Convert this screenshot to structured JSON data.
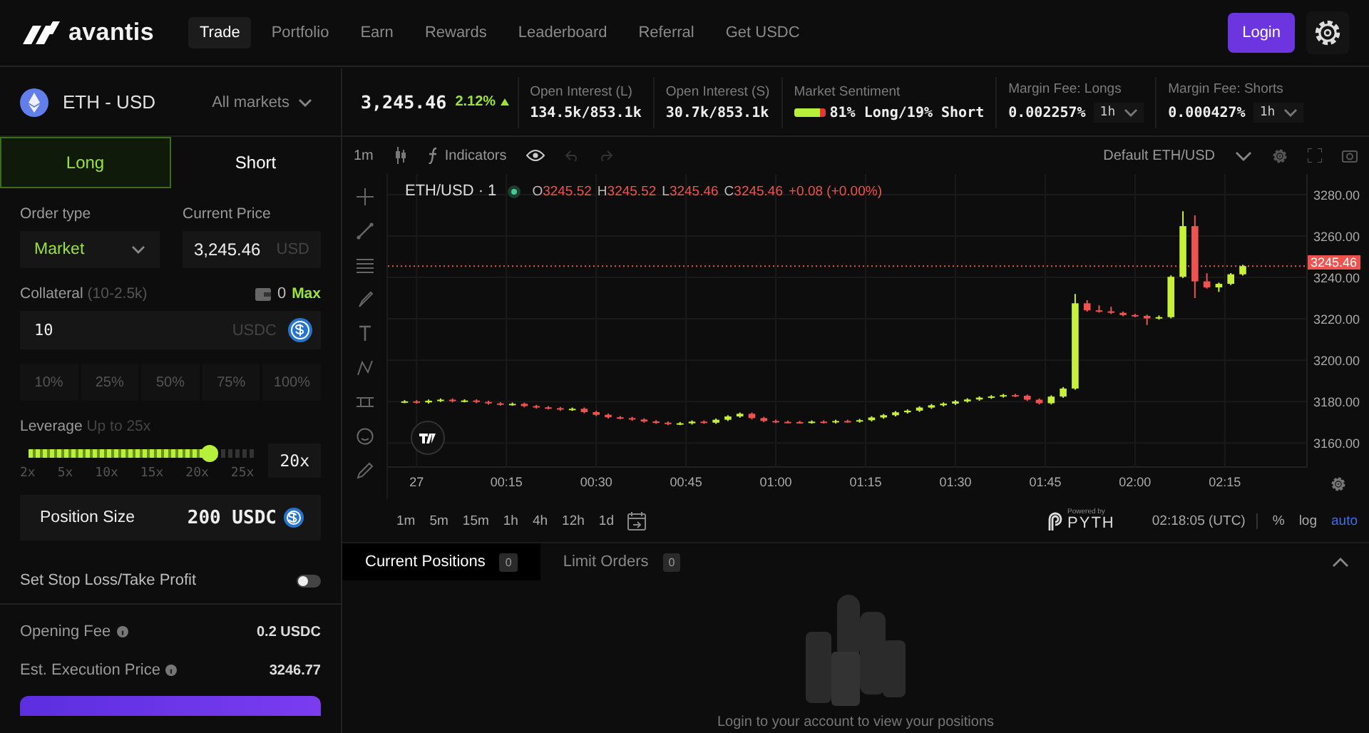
{
  "nav": {
    "brand": "avantis",
    "links": [
      {
        "label": "Trade",
        "selected": true
      },
      {
        "label": "Portfolio",
        "selected": false
      },
      {
        "label": "Earn",
        "selected": false
      },
      {
        "label": "Rewards",
        "selected": false
      },
      {
        "label": "Leaderboard",
        "selected": false
      },
      {
        "label": "Referral",
        "selected": false
      },
      {
        "label": "Get USDC",
        "selected": false
      }
    ],
    "login": "Login"
  },
  "market": {
    "pair": "ETH - USD",
    "selector": "All markets",
    "price": "3,245.46",
    "change": "2.12%",
    "stats": [
      {
        "kind": "plain",
        "label": "Open Interest (L)",
        "value": "134.5k/853.1k"
      },
      {
        "kind": "plain",
        "label": "Open Interest (S)",
        "value": "30.7k/853.1k"
      },
      {
        "kind": "sentiment",
        "label": "Market Sentiment",
        "value": "81% Long/19% Short",
        "level": 0.81
      },
      {
        "kind": "fee",
        "label": "Margin Fee: Longs",
        "value": "0.002257%",
        "period": "1h"
      },
      {
        "kind": "fee",
        "label": "Margin Fee: Shorts",
        "value": "0.000427%",
        "period": "1h"
      }
    ]
  },
  "order": {
    "sides": [
      {
        "label": "Long",
        "selected": true
      },
      {
        "label": "Short",
        "selected": false
      }
    ],
    "order_type_label": "Order type",
    "order_type": "Market",
    "current_price_label": "Current Price",
    "current_price": "3,245.46",
    "current_price_unit": "USD",
    "collateral_label": "Collateral",
    "collateral_range": "(10-2.5k)",
    "balance": "0",
    "max": "Max",
    "collateral_value": "10",
    "collateral_unit": "USDC",
    "percents": [
      "10%",
      "25%",
      "50%",
      "75%",
      "100%"
    ],
    "leverage_label": "Leverage",
    "leverage_hint": "Up to 25x",
    "leverage": {
      "level": 0.8
    },
    "leverage_ticks": [
      "2x",
      "5x",
      "10x",
      "15x",
      "20x",
      "25x"
    ],
    "leverage_value": "20x",
    "position_size_label": "Position Size",
    "position_size": "200 USDC",
    "sltp_label": "Set Stop Loss/Take Profit",
    "sltp_on": false,
    "fees": [
      {
        "label": "Opening Fee",
        "value": "0.2 USDC"
      },
      {
        "label": "Est. Execution Price",
        "value": "3246.77"
      }
    ]
  },
  "chart": {
    "interval": "1m",
    "indicators": "Indicators",
    "layout": "Default ETH/USD",
    "symbol": "ETH/USD · 1",
    "ohlc": [
      {
        "key": "O",
        "value": "3245.52"
      },
      {
        "key": "H",
        "value": "3245.52"
      },
      {
        "key": "L",
        "value": "3245.46"
      },
      {
        "key": "C",
        "value": "3245.46"
      }
    ],
    "change": "+0.08 (+0.00%)",
    "last_price": "3245.46",
    "day_label": "27",
    "chart_data": {
      "type": "candlestick",
      "grid": true,
      "ref_lines": [
        {
          "axis": "y",
          "value": 3245.46,
          "color": "#ef5350"
        }
      ],
      "xlim": [
        -4.8,
        148.6
      ],
      "ylim": [
        3148,
        3290
      ],
      "xticks": [
        {
          "value": 15,
          "label": "00:15"
        },
        {
          "value": 30,
          "label": "00:30"
        },
        {
          "value": 45,
          "label": "00:45"
        },
        {
          "value": 60,
          "label": "01:00"
        },
        {
          "value": 75,
          "label": "01:15"
        },
        {
          "value": 90,
          "label": "01:30"
        },
        {
          "value": 105,
          "label": "01:45"
        },
        {
          "value": 120,
          "label": "02:00"
        },
        {
          "value": 135,
          "label": "02:15"
        }
      ],
      "yticks": [
        {
          "value": 3280,
          "label": "3280.00"
        },
        {
          "value": 3260,
          "label": "3260.00"
        },
        {
          "value": 3240,
          "label": "3240.00"
        },
        {
          "value": 3220,
          "label": "3220.00"
        },
        {
          "value": 3200,
          "label": "3200.00"
        },
        {
          "value": 3180,
          "label": "3180.00"
        },
        {
          "value": 3160,
          "label": "3160.00"
        }
      ],
      "x": [
        -2,
        0,
        2,
        4,
        6,
        8,
        10,
        12,
        14,
        16,
        18,
        20,
        22,
        24,
        26,
        28,
        30,
        32,
        34,
        36,
        38,
        40,
        42,
        44,
        46,
        48,
        50,
        52,
        54,
        56,
        58,
        60,
        62,
        64,
        66,
        68,
        70,
        72,
        74,
        76,
        78,
        80,
        82,
        84,
        86,
        88,
        90,
        92,
        94,
        96,
        98,
        100,
        102,
        104,
        106,
        108,
        110,
        112,
        114,
        116,
        118,
        120,
        122,
        124,
        126,
        128,
        130,
        132,
        134,
        136,
        138
      ],
      "ohlc": [
        [
          3179.8,
          3180.7,
          3179.2,
          3180.1
        ],
        [
          3180.1,
          3180.7,
          3179.0,
          3179.6
        ],
        [
          3179.6,
          3181.0,
          3179.0,
          3180.4
        ],
        [
          3180.4,
          3181.5,
          3179.8,
          3180.9
        ],
        [
          3180.9,
          3181.5,
          3179.6,
          3180.2
        ],
        [
          3180.2,
          3181.1,
          3179.6,
          3180.5
        ],
        [
          3180.5,
          3181.1,
          3179.2,
          3179.8
        ],
        [
          3179.8,
          3180.4,
          3178.5,
          3179.1
        ],
        [
          3179.1,
          3179.7,
          3178.0,
          3178.6
        ],
        [
          3178.6,
          3179.5,
          3178.0,
          3178.9
        ],
        [
          3178.9,
          3179.5,
          3177.2,
          3177.8
        ],
        [
          3177.8,
          3178.4,
          3176.6,
          3177.2
        ],
        [
          3177.2,
          3177.8,
          3176.2,
          3176.8
        ],
        [
          3176.8,
          3177.4,
          3175.5,
          3176.1
        ],
        [
          3176.1,
          3177.1,
          3175.5,
          3176.5
        ],
        [
          3176.5,
          3177.1,
          3174.3,
          3174.9
        ],
        [
          3174.9,
          3175.5,
          3173.0,
          3173.6
        ],
        [
          3173.6,
          3174.2,
          3171.8,
          3172.4
        ],
        [
          3172.4,
          3173.0,
          3171.4,
          3172.0
        ],
        [
          3172.0,
          3172.6,
          3170.7,
          3171.3
        ],
        [
          3171.3,
          3171.9,
          3169.8,
          3170.4
        ],
        [
          3170.4,
          3171.0,
          3169.2,
          3169.8
        ],
        [
          3169.8,
          3170.4,
          3168.6,
          3169.2
        ],
        [
          3169.2,
          3170.1,
          3168.6,
          3169.5
        ],
        [
          3169.5,
          3170.9,
          3168.9,
          3170.3
        ],
        [
          3170.3,
          3170.9,
          3169.2,
          3169.8
        ],
        [
          3169.8,
          3171.8,
          3169.2,
          3171.2
        ],
        [
          3171.2,
          3173.4,
          3170.6,
          3172.8
        ],
        [
          3172.8,
          3174.7,
          3172.2,
          3174.1
        ],
        [
          3174.1,
          3174.7,
          3171.4,
          3172.0
        ],
        [
          3172.0,
          3172.6,
          3170.0,
          3170.6
        ],
        [
          3170.6,
          3171.2,
          3169.6,
          3170.2
        ],
        [
          3170.2,
          3170.8,
          3169.5,
          3170.1
        ],
        [
          3170.1,
          3170.7,
          3169.3,
          3169.9
        ],
        [
          3169.9,
          3170.9,
          3169.3,
          3170.3
        ],
        [
          3170.3,
          3170.9,
          3169.4,
          3170.0
        ],
        [
          3170.0,
          3171.2,
          3169.4,
          3170.6
        ],
        [
          3170.6,
          3171.2,
          3169.8,
          3170.4
        ],
        [
          3170.4,
          3171.6,
          3169.8,
          3171.0
        ],
        [
          3171.0,
          3172.9,
          3170.4,
          3172.3
        ],
        [
          3172.3,
          3174.0,
          3171.7,
          3173.4
        ],
        [
          3173.4,
          3175.4,
          3172.8,
          3174.8
        ],
        [
          3174.8,
          3176.2,
          3174.2,
          3175.6
        ],
        [
          3175.6,
          3177.7,
          3175.0,
          3177.1
        ],
        [
          3177.1,
          3178.8,
          3176.5,
          3178.2
        ],
        [
          3178.2,
          3179.6,
          3177.6,
          3179.0
        ],
        [
          3179.0,
          3180.7,
          3178.4,
          3180.1
        ],
        [
          3180.1,
          3181.6,
          3179.5,
          3181.0
        ],
        [
          3181.0,
          3182.5,
          3180.4,
          3181.9
        ],
        [
          3181.9,
          3183.1,
          3181.3,
          3182.5
        ],
        [
          3182.5,
          3183.7,
          3181.9,
          3183.1
        ],
        [
          3183.1,
          3183.7,
          3182.2,
          3182.8
        ],
        [
          3182.8,
          3183.4,
          3180.3,
          3180.9
        ],
        [
          3180.9,
          3181.5,
          3178.6,
          3179.2
        ],
        [
          3179.2,
          3183.0,
          3178.6,
          3182.4
        ],
        [
          3182.4,
          3187.0,
          3181.8,
          3186.3
        ],
        [
          3186.3,
          3232.0,
          3185.7,
          3227.5
        ],
        [
          3227.5,
          3229.0,
          3223.5,
          3224.1
        ],
        [
          3224.1,
          3226.5,
          3223.0,
          3223.6
        ],
        [
          3223.6,
          3225.8,
          3222.3,
          3222.9
        ],
        [
          3222.9,
          3223.5,
          3221.2,
          3221.8
        ],
        [
          3221.8,
          3222.4,
          3220.8,
          3221.4
        ],
        [
          3221.4,
          3222.0,
          3217.0,
          3220.2
        ],
        [
          3220.2,
          3221.6,
          3219.6,
          3220.8
        ],
        [
          3220.8,
          3241.0,
          3220.2,
          3240.3
        ],
        [
          3240.3,
          3272.0,
          3239.7,
          3264.8
        ],
        [
          3264.8,
          3270.0,
          3230.0,
          3238.1
        ],
        [
          3238.1,
          3242.0,
          3234.6,
          3235.2
        ],
        [
          3235.2,
          3237.5,
          3233.0,
          3236.9
        ],
        [
          3236.9,
          3242.1,
          3236.3,
          3241.5
        ],
        [
          3241.5,
          3246.1,
          3240.9,
          3245.46
        ]
      ]
    },
    "intervals": [
      "1m",
      "5m",
      "15m",
      "1h",
      "4h",
      "12h",
      "1d"
    ],
    "powered": "Powered by",
    "provider": "PYTH",
    "clock": "02:18:05 (UTC)",
    "scale_options": [
      {
        "label": "%",
        "selected": false
      },
      {
        "label": "log",
        "selected": false
      },
      {
        "label": "auto",
        "selected": true
      }
    ]
  },
  "positions": {
    "tabs": [
      {
        "label": "Current Positions",
        "count": "0",
        "selected": true
      },
      {
        "label": "Limit Orders",
        "count": "0",
        "selected": false
      }
    ],
    "empty_message": "Login to your account to view your positions"
  }
}
